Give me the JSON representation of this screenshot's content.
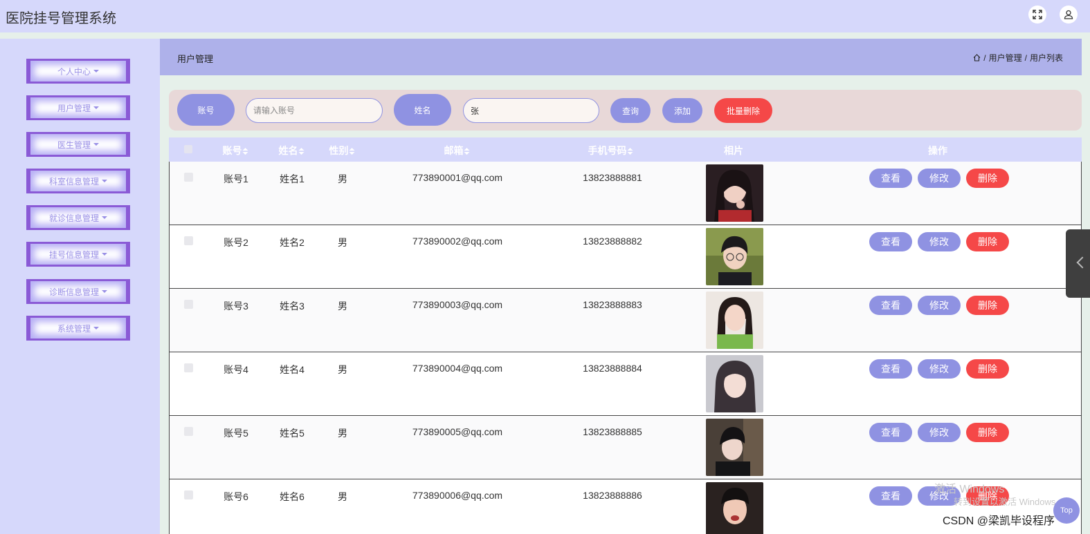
{
  "app": {
    "title": "医院挂号管理系统"
  },
  "header_icons": {
    "fullscreen": "fullscreen-icon",
    "user": "user-icon"
  },
  "sidebar": {
    "items": [
      {
        "label": "个人中心"
      },
      {
        "label": "用户管理"
      },
      {
        "label": "医生管理"
      },
      {
        "label": "科室信息管理"
      },
      {
        "label": "就诊信息管理"
      },
      {
        "label": "挂号信息管理"
      },
      {
        "label": "诊断信息管理"
      },
      {
        "label": "系统管理"
      }
    ]
  },
  "page": {
    "title": "用户管理",
    "breadcrumb": [
      "用户管理",
      "用户列表"
    ],
    "breadcrumb_sep": "/"
  },
  "search": {
    "account_label": "账号",
    "account_placeholder": "请输入账号",
    "account_value": "",
    "name_label": "姓名",
    "name_value": "张",
    "query_button": "查询",
    "add_button": "添加",
    "batch_delete_button": "批量删除"
  },
  "table": {
    "columns": [
      "账号",
      "姓名",
      "性别",
      "邮箱",
      "手机号码",
      "相片",
      "操作"
    ],
    "rows": [
      {
        "account": "账号1",
        "name": "姓名1",
        "gender": "男",
        "email": "773890001@qq.com",
        "phone": "13823888881"
      },
      {
        "account": "账号2",
        "name": "姓名2",
        "gender": "男",
        "email": "773890002@qq.com",
        "phone": "13823888882"
      },
      {
        "account": "账号3",
        "name": "姓名3",
        "gender": "男",
        "email": "773890003@qq.com",
        "phone": "13823888883"
      },
      {
        "account": "账号4",
        "name": "姓名4",
        "gender": "男",
        "email": "773890004@qq.com",
        "phone": "13823888884"
      },
      {
        "account": "账号5",
        "name": "姓名5",
        "gender": "男",
        "email": "773890005@qq.com",
        "phone": "13823888885"
      },
      {
        "account": "账号6",
        "name": "姓名6",
        "gender": "男",
        "email": "773890006@qq.com",
        "phone": "13823888886"
      }
    ],
    "actions": {
      "view": "查看",
      "edit": "修改",
      "delete": "删除"
    }
  },
  "overlay": {
    "activate_windows": "激活 Windows",
    "activate_windows_sub": "转到设置以激活 Windows。",
    "csdn": "CSDN @梁凯毕设程序",
    "top_button": "Top"
  },
  "colors": {
    "accent": "#8f92e2",
    "danger": "#f54848",
    "sidebar_bg": "#d6d8fb",
    "header_strip": "#aeb1ea",
    "menu_border": "#8a5ad6"
  }
}
